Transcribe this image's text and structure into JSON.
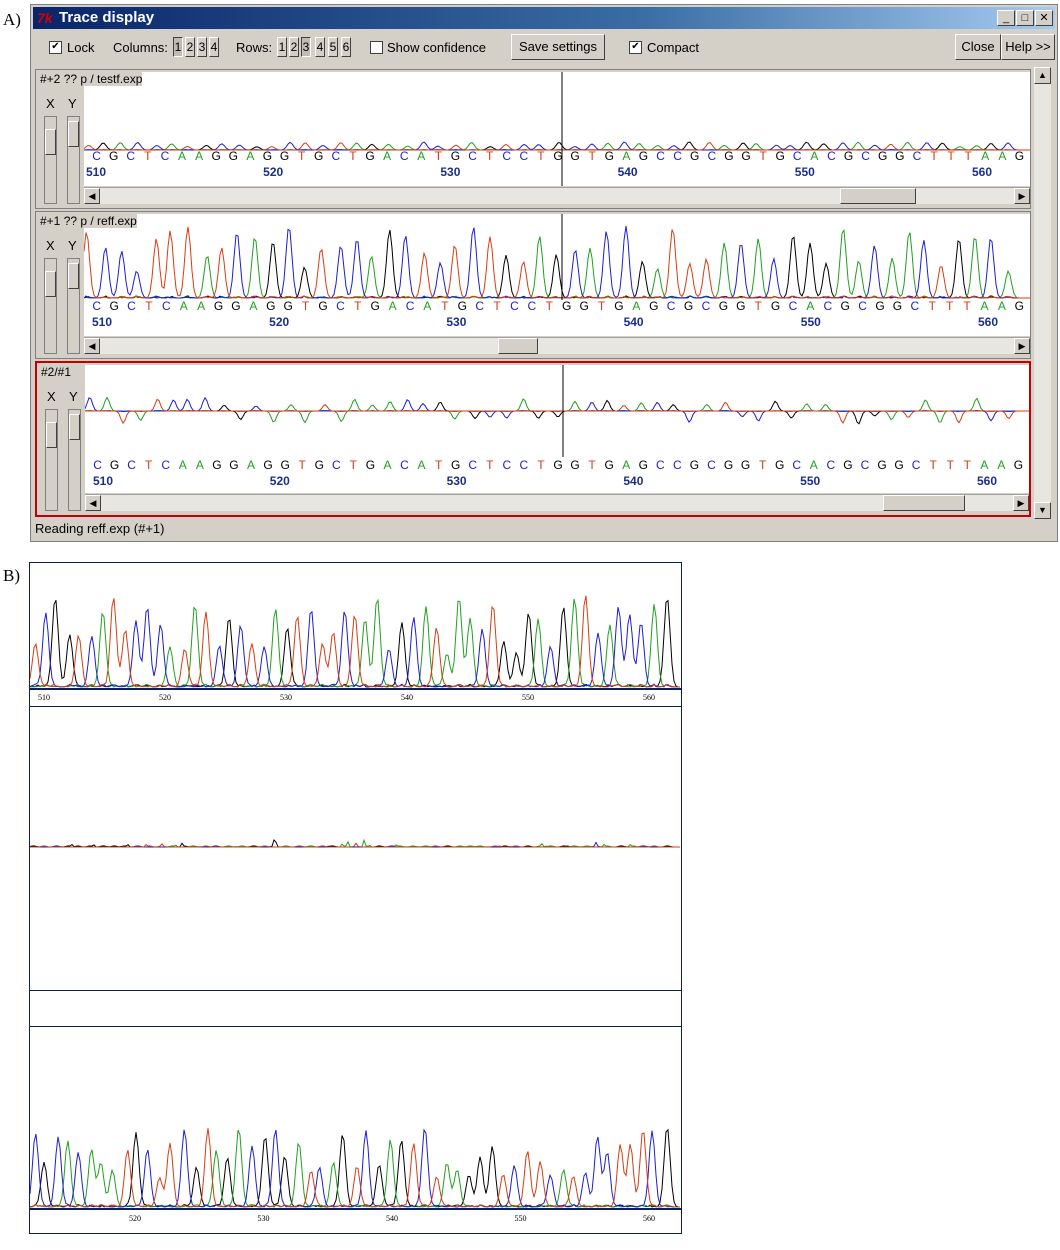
{
  "panel_a_label": "A)",
  "panel_b_label": "B)",
  "window": {
    "title": "Trace display",
    "min_glyph": "_",
    "max_glyph": "□",
    "close_glyph": "✕"
  },
  "toolbar": {
    "lock_label": "Lock",
    "lock_checked": true,
    "columns_label": "Columns:",
    "columns": [
      "1",
      "2",
      "3",
      "4"
    ],
    "columns_selected": "1",
    "rows_label": "Rows:",
    "rows": [
      "1",
      "2",
      "3",
      "4",
      "5",
      "6"
    ],
    "rows_selected": "3",
    "show_confidence_label": "Show confidence",
    "show_confidence_checked": false,
    "save_settings_label": "Save settings",
    "compact_label": "Compact",
    "compact_checked": true,
    "close_label": "Close",
    "help_label": "Help >>"
  },
  "axis_labels": {
    "x": "X",
    "y": "Y"
  },
  "traces": [
    {
      "label": "#+2 ?? p / testf.exp",
      "sequence": "CGCTCAAGGAGGTGCTGACATGCTCCTGGTGAGCCGCGGTGCACGCGGCTTTAAG",
      "positions": [
        "510",
        "520",
        "530",
        "540",
        "550",
        "560"
      ]
    },
    {
      "label": "#+1 ?? p / reff.exp",
      "sequence": "CGCTCAAGGAGGTGCTGACATGCTCCTGGTGAGCGCGGTGCACGCGGCTTTAAG",
      "positions": [
        "510",
        "520",
        "530",
        "540",
        "550",
        "560"
      ]
    },
    {
      "label": "#2/#1",
      "sequence": "CGCTCAAGGAGGTGCTGACATGCTCCTGGTGAGCCGCGGTGCACGCGGCTTTAAG",
      "positions": [
        "510",
        "520",
        "530",
        "540",
        "550",
        "560"
      ]
    }
  ],
  "status_text": "Reading reff.exp (#+1)",
  "panel_b": {
    "top_positions": [
      "510",
      "520",
      "530",
      "540",
      "550",
      "560"
    ],
    "bottom_positions": [
      "520",
      "530",
      "540",
      "550",
      "560"
    ]
  },
  "colors": {
    "A": "#20a020",
    "C": "#1c1cd8",
    "G": "#000000",
    "T": "#d83c10",
    "active_border": "#c00000",
    "number": "#1a2f8a"
  }
}
